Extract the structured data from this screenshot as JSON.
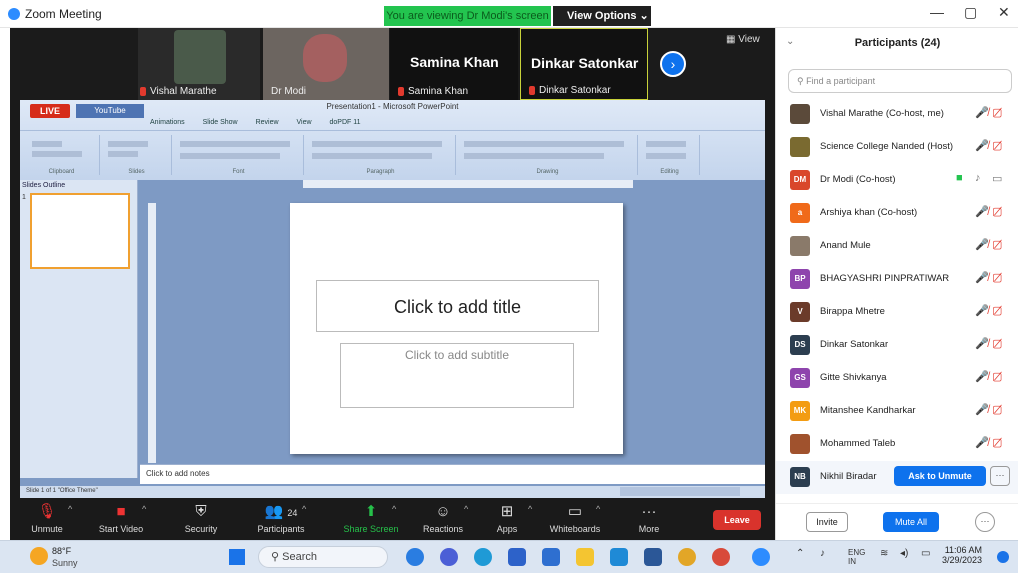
{
  "window": {
    "title": "Zoom Meeting",
    "viewing": "You are viewing Dr Modi's screen",
    "view_options": "View Options"
  },
  "gallery": {
    "tiles": [
      "Vishal Marathe",
      "Dr Modi",
      "Samina Khan",
      "Dinkar Satonkar"
    ],
    "view_label": "View"
  },
  "ppt": {
    "live": "LIVE",
    "youtube": "YouTube",
    "doc_title": "Presentation1 - Microsoft PowerPoint",
    "menu": [
      "Animations",
      "Slide Show",
      "Review",
      "View",
      "doPDF 11"
    ],
    "groups": [
      "Clipboard",
      "Slides",
      "Font",
      "Paragraph",
      "Drawing",
      "Editing"
    ],
    "tabs": "Slides  Outline",
    "slide_num": "1",
    "title_ph": "Click to add title",
    "subtitle_ph": "Click to add subtitle",
    "notes_ph": "Click to add notes",
    "status": "Slide 1 of 1    \"Office Theme\""
  },
  "toolbar": {
    "unmute": "Unmute",
    "start_video": "Start Video",
    "security": "Security",
    "participants": "Participants",
    "participants_count": "24",
    "share_screen": "Share Screen",
    "reactions": "Reactions",
    "apps": "Apps",
    "whiteboards": "Whiteboards",
    "more": "More",
    "leave": "Leave"
  },
  "panel": {
    "title": "Participants (24)",
    "search_placeholder": "Find a participant",
    "participants": [
      {
        "initials": "",
        "color": "#5b4a3a",
        "name": "Vishal Marathe (Co-host, me)"
      },
      {
        "initials": "",
        "color": "#7a6a30",
        "name": "Science College Nanded (Host)"
      },
      {
        "initials": "DM",
        "color": "#d9472b",
        "name": "Dr Modi (Co-host)"
      },
      {
        "initials": "a",
        "color": "#f06a1a",
        "name": "Arshiya khan (Co-host)"
      },
      {
        "initials": "",
        "color": "#8a7a6a",
        "name": "Anand Mule"
      },
      {
        "initials": "BP",
        "color": "#8e44ad",
        "name": "BHAGYASHRI PINPRATIWAR"
      },
      {
        "initials": "V",
        "color": "#6b3b2a",
        "name": "Birappa Mhetre"
      },
      {
        "initials": "DS",
        "color": "#2c3e50",
        "name": "Dinkar Satonkar"
      },
      {
        "initials": "GS",
        "color": "#8e44ad",
        "name": "Gitte Shivkanya"
      },
      {
        "initials": "MK",
        "color": "#f39c12",
        "name": "Mitanshee Kandharkar"
      },
      {
        "initials": "",
        "color": "#a0522d",
        "name": "Mohammed Taleb"
      },
      {
        "initials": "NB",
        "color": "#2c3e50",
        "name": "Nikhil Biradar"
      }
    ],
    "ask_unmute": "Ask to Unmute",
    "invite": "Invite",
    "mute_all": "Mute All"
  },
  "taskbar": {
    "temp": "88°F",
    "weather": "Sunny",
    "search": "Search",
    "lang1": "ENG",
    "lang2": "IN",
    "time": "11:06 AM",
    "date": "3/29/2023"
  }
}
